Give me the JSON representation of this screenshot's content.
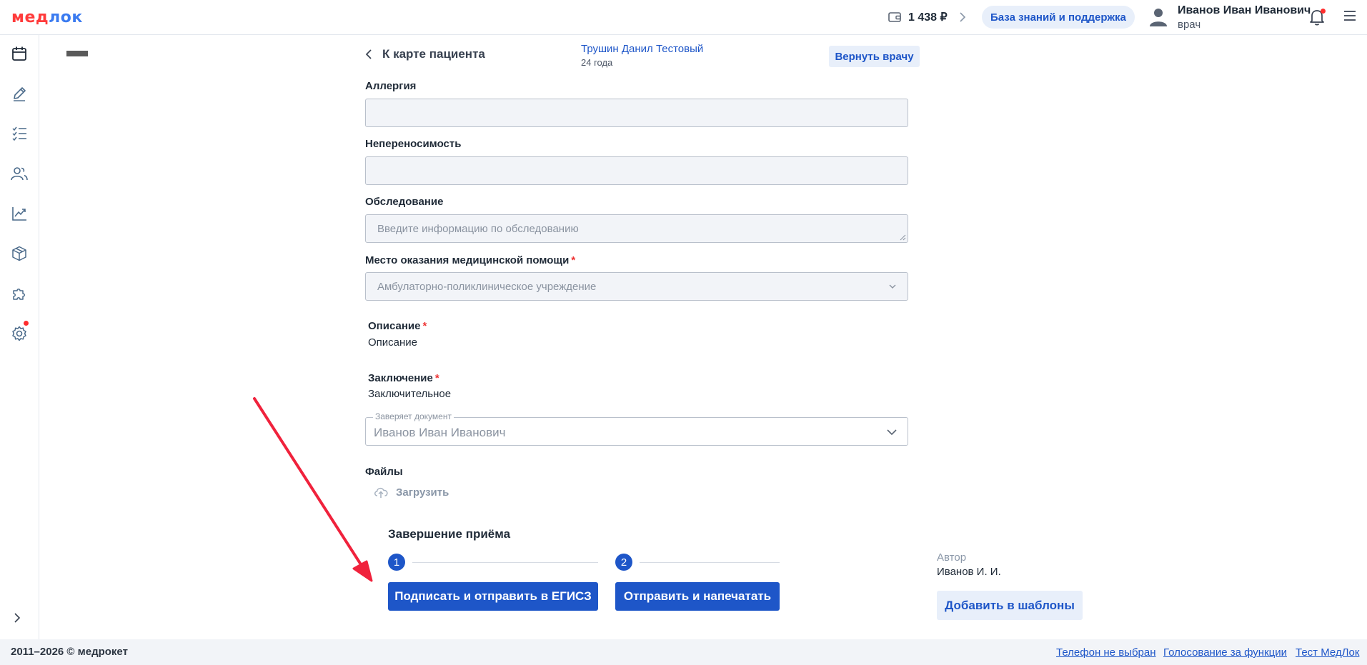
{
  "header": {
    "logo_part1": "мед",
    "logo_part2": "лок",
    "balance": "1 438 ₽",
    "knowledge_base_label": "База знаний и поддержка",
    "user_name": "Иванов Иван Иванович",
    "user_role": "врач"
  },
  "sidebar": {
    "items": [
      "calendar-icon",
      "pen-icon",
      "checklist-icon",
      "users-icon",
      "chart-icon",
      "box-icon",
      "puzzle-icon",
      "settings-icon"
    ],
    "notification_dot_color": "#ff2d2d"
  },
  "nav": {
    "back_label": "К карте пациента",
    "patient_name": "Трушин Данил Тестовый",
    "patient_age": "24 года",
    "return_label": "Вернуть врачу"
  },
  "form": {
    "allergy_label": "Аллергия",
    "intolerance_label": "Непереносимость",
    "exam_label": "Обследование",
    "exam_placeholder": "Введите информацию по обследованию",
    "place_label": "Место оказания медицинской помощи",
    "place_value": "Амбулаторно-поликлиническое учреждение",
    "required_mark": "*",
    "description_label": "Описание",
    "description_value": "Описание",
    "conclusion_label": "Заключение",
    "conclusion_value": "Заключительное",
    "signer_legend": "Заверяет документ",
    "signer_value": "Иванов Иван Иванович",
    "files_label": "Файлы",
    "upload_label": "Загрузить"
  },
  "finish": {
    "title": "Завершение приёма",
    "step1_number": "1",
    "step2_number": "2",
    "sign_button": "Подписать и отправить в ЕГИСЗ",
    "send_button": "Отправить и напечатать"
  },
  "author": {
    "label": "Автор",
    "value": "Иванов И. И.",
    "template_button": "Добавить в шаблоны"
  },
  "footer": {
    "copyright": "2011–2026 © медрокет",
    "link_phone": "Телефон не выбран",
    "link_vote": "Голосование за функции",
    "link_test": "Тест МедЛок"
  },
  "colors": {
    "primary": "#1e56c8",
    "light_button_bg": "#e8effa",
    "annotation_arrow": "#f0223c"
  }
}
